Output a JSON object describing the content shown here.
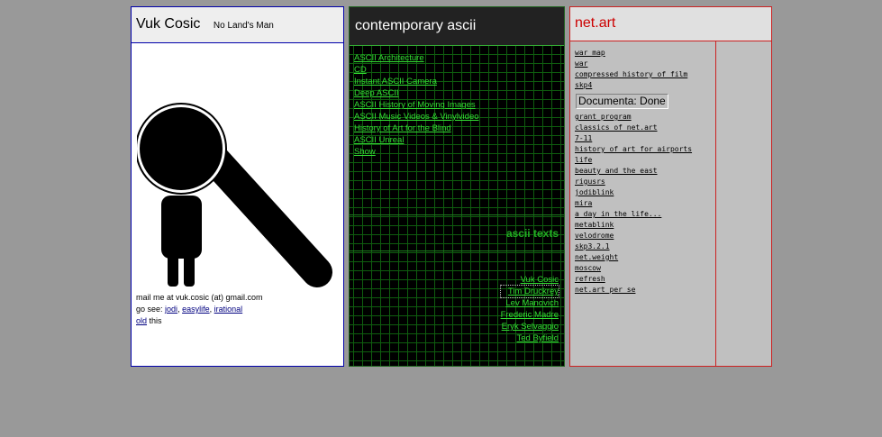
{
  "left": {
    "name": "Vuk Cosic",
    "tagline": "No Land's Man",
    "mail": "mail me at vuk.cosic (at) gmail.com",
    "go_see": "go see:",
    "links": [
      "jodi",
      "easylife",
      "irational",
      "old"
    ],
    "this": "this",
    "comma": ","
  },
  "middle": {
    "title": "contemporary ascii",
    "links": [
      "ASCII Architecture",
      "CD",
      "Instant ASCII Camera",
      "Deep ASCII",
      "ASCII History of Moving Images",
      "ASCII Music Videos & Vinylvideo",
      "History of Art for the Blind",
      "ASCII Unreal",
      "Show"
    ],
    "texts_label": "ascii texts",
    "people": [
      "Vuk Cosic",
      "Tim Druckrey",
      "Lev Manovich",
      "Frederic Madre",
      "Eryk Selvaggio",
      "Ted Byfield"
    ]
  },
  "right": {
    "title": "net.art",
    "links_top": [
      "war map",
      "war",
      "compressed history of film",
      "skp4"
    ],
    "documenta": "Documenta: Done",
    "links_bottom": [
      "grant program",
      "classics of net.art",
      "7-11",
      "history of art for airports",
      "life",
      "beauty and the east",
      "rigusrs",
      "jodiblink",
      "mira",
      "a day in the life...",
      "metablink",
      "velodrome",
      "skp3.2.1",
      "net.weight",
      "moscow",
      "refresh",
      "net.art per se"
    ]
  },
  "colors": {
    "background": "#999999",
    "left_border": "#0000aa",
    "mid_link": "#33dd33",
    "right_accent": "#cc0000"
  }
}
